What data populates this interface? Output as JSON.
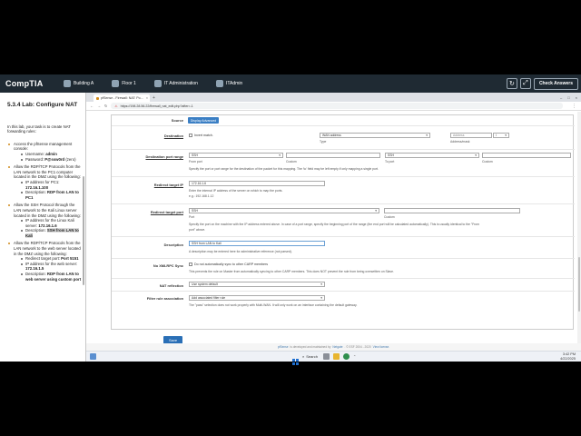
{
  "header": {
    "logo": "CompTIA",
    "nav": [
      {
        "label": "Building A",
        "icon": "building-icon"
      },
      {
        "label": "Floor 1",
        "icon": "floor-icon"
      },
      {
        "label": "IT Administration",
        "icon": "monitor-icon"
      },
      {
        "label": "ITAdmin",
        "icon": "computer-icon"
      }
    ],
    "refresh_icon": "↻",
    "fullscreen_icon": "⤢",
    "check_answers": "Check Answers",
    "bg_color": "#1f2a33"
  },
  "lab": {
    "title": "5.3.4 Lab: Configure NAT",
    "intro": "In this lab, your task is to create NAT forwarding rules:",
    "tasks": [
      {
        "text": "Access the pfSense management console:",
        "items": [
          {
            "label": "Username: ",
            "value": "admin"
          },
          {
            "label": "Password: ",
            "value": "P@ssw0rd",
            "suffix": " (zero)"
          }
        ]
      },
      {
        "text": "Allow the RDP/TCP Protocols from the LAN network to the PC1 computer located in the DMZ using the following:",
        "items": [
          {
            "label": "IP address for PC1: ",
            "value": "172.16.1.100"
          },
          {
            "label": "Description: ",
            "value": "RDP from LAN to PC1"
          }
        ]
      },
      {
        "text": "Allow the SSH Protocol through the LAN network to the Kali Linux server located in the DMZ using the following:",
        "items": [
          {
            "label": "IP address for the Linux Kali server: ",
            "value": "172.16.1.6"
          },
          {
            "label": "Description: ",
            "value": "SSH from LAN to Kali",
            "highlight": true
          }
        ]
      },
      {
        "text": "Allow the RDP/TCP Protocols from the LAN network to the web server located in the DMZ using the following:",
        "items": [
          {
            "label": "Redirect target port: ",
            "value": "Port 5151"
          },
          {
            "label": "IP address for the web server: ",
            "value": "172.16.1.5"
          },
          {
            "label": "Description: ",
            "value": "RDP from LAN to web server using custom port"
          }
        ]
      }
    ]
  },
  "browser": {
    "tab_title": "pfSense - Firewall: NAT: Po...",
    "tab_close": "×",
    "new_tab": "+",
    "win_min": "–",
    "win_max": "□",
    "win_close": "×",
    "back": "←",
    "forward": "→",
    "reload": "↻",
    "not_secure": "⚠",
    "url": "https://198.28.56.22/firewall_nat_edit.php?after=-1",
    "menu": "⋮"
  },
  "form": {
    "source_label": "Source",
    "display_advanced": "Display Advanced",
    "destination": {
      "label": "Destination",
      "invert": "Invert match.",
      "type_value": "WAN address",
      "type_sub": "Type",
      "address_value": "Address",
      "mask_value": "/",
      "address_sub": "Address/mask"
    },
    "dest_port_range": {
      "label": "Destination port range",
      "from_value": "SSH",
      "from_sub": "From port",
      "custom1_sub": "Custom",
      "to_value": "SSH",
      "to_sub": "To port",
      "custom2_sub": "Custom",
      "help": "Specify the port or port range for the destination of the packet for this mapping. The 'to' field may be left empty if only mapping a single port."
    },
    "redirect_ip": {
      "label": "Redirect target IP",
      "value": "172.16.1.6",
      "help1": "Enter the internal IP address of the server on which to map the ports.",
      "help2": "e.g.: 192.168.1.12"
    },
    "redirect_port": {
      "label": "Redirect target port",
      "port_value": "SSH",
      "port_sub": "Port",
      "custom_sub": "Custom",
      "help1": "Specify the port on the machine with the IP address entered above. In case of a port range, specify the beginning port of the range (the end port will be calculated automatically). This is usually identical to the \"From",
      "help2": "port\" above."
    },
    "description": {
      "label": "Description",
      "value": "SSH from LAN to Kali",
      "help": "A description may be entered here for administrative reference (not parsed)."
    },
    "no_xmlrpc": {
      "label": "No XMLRPC Sync",
      "text": "Do not automatically sync to other CARP members",
      "help": "This prevents the rule on Master from automatically syncing to other CARP members. This does NOT prevent the rule from being overwritten on Slave."
    },
    "nat_reflection": {
      "label": "NAT reflection",
      "value": "Use system default"
    },
    "filter_rule": {
      "label": "Filter rule association",
      "value": "Add associated filter rule",
      "help": "The \"pass\" selection does not work properly with Multi-WAN. It will only work on an interface containing the default gateway."
    },
    "save": "Save"
  },
  "footer": {
    "pre": "pfSense",
    "mid": " is developed and maintained by ",
    "netgate": "Netgate",
    "post": ". © ESF 2004 - 2020 ",
    "license": "View license."
  },
  "taskbar": {
    "search": "Search",
    "time": "3:42 PM",
    "date": "4/22/2025",
    "tray": "⌃"
  }
}
